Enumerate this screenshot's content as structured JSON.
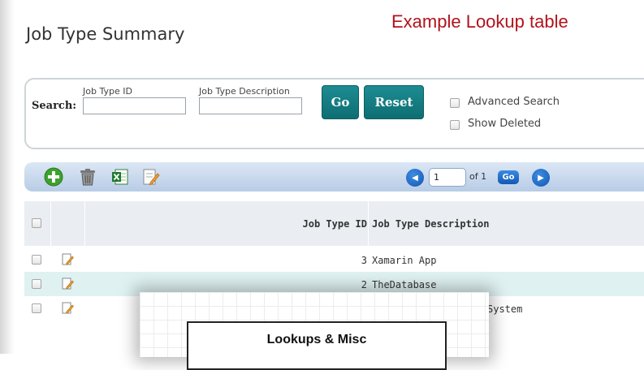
{
  "page": {
    "title": "Job Type Summary",
    "annotation": "Example Lookup table"
  },
  "search": {
    "label": "Search:",
    "fields": [
      {
        "label": "Job Type ID",
        "value": ""
      },
      {
        "label": "Job Type Description",
        "value": ""
      }
    ],
    "go_label": "Go",
    "reset_label": "Reset",
    "options": [
      {
        "label": "Advanced Search",
        "checked": false
      },
      {
        "label": "Show Deleted",
        "checked": false
      }
    ]
  },
  "toolbar": {
    "icons": [
      "add-icon",
      "delete-icon",
      "excel-export-icon",
      "edit-form-icon"
    ],
    "pager": {
      "page_value": "1",
      "of_text": "of 1",
      "go_label": "Go"
    }
  },
  "grid": {
    "columns": [
      "Job Type ID",
      "Job Type Description"
    ],
    "rows": [
      {
        "id": "3",
        "description": "Xamarin App",
        "highlighted": false
      },
      {
        "id": "2",
        "description": "TheDatabase",
        "highlighted": true
      },
      {
        "id": "",
        "description": "System",
        "highlighted": false
      }
    ]
  },
  "overlay": {
    "title": "Lookups & Misc"
  },
  "colors": {
    "accent_teal": "#0d6e73",
    "annotation_red": "#b3121b",
    "toolbar_blue": "#b8cce6",
    "row_highlight": "#dff1f1"
  }
}
